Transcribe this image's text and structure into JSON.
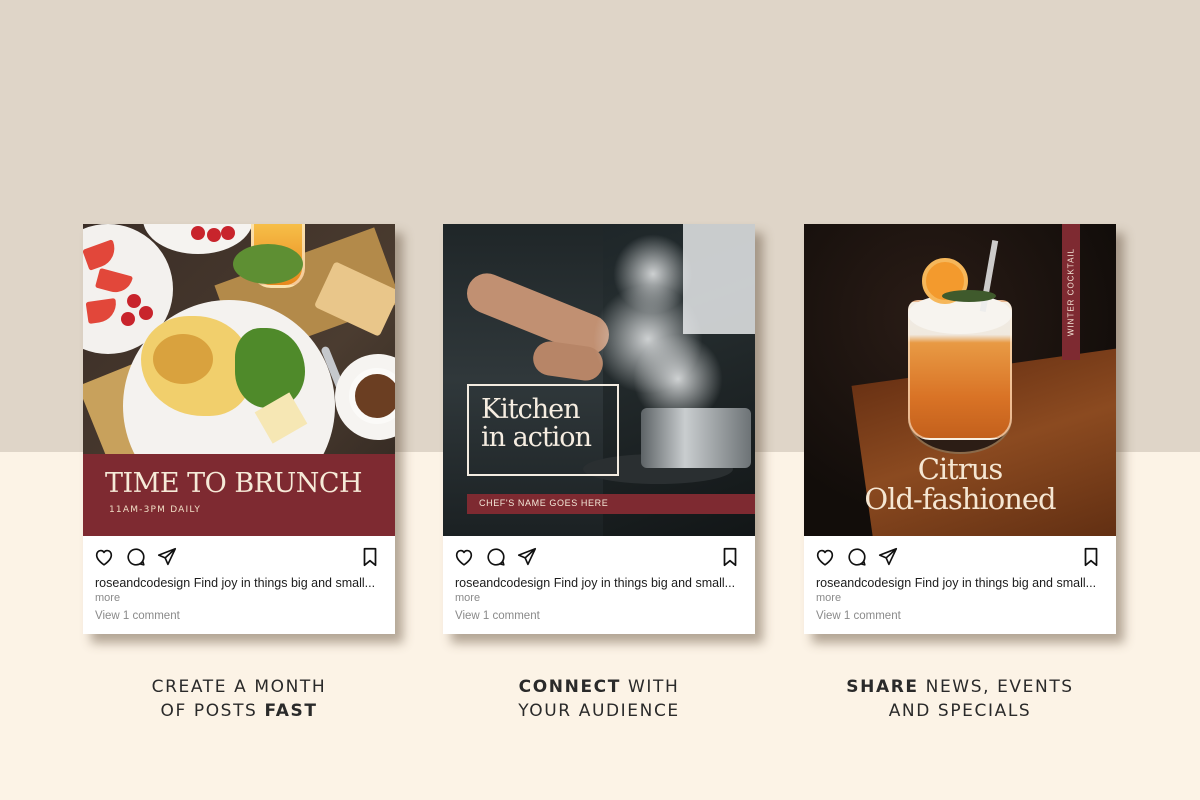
{
  "colors": {
    "top_background": "#dfd5c8",
    "bottom_background": "#fcf3e6",
    "accent_burgundy": "#7e2a31"
  },
  "posts": [
    {
      "overlay": {
        "title": "TIME TO BRUNCH",
        "subtitle": "11AM-3PM DAILY"
      },
      "username": "roseandcodesign",
      "caption": "Find joy in things big and small...",
      "more": "more",
      "comments": "View 1 comment",
      "icons": [
        "heart-icon",
        "comment-icon",
        "share-icon",
        "bookmark-icon"
      ]
    },
    {
      "overlay": {
        "title_line1": "Kitchen",
        "title_line2": "in action",
        "subtitle": "CHEF'S NAME GOES HERE"
      },
      "username": "roseandcodesign",
      "caption": "Find joy in things big and small...",
      "more": "more",
      "comments": "View 1 comment",
      "icons": [
        "heart-icon",
        "comment-icon",
        "share-icon",
        "bookmark-icon"
      ]
    },
    {
      "overlay": {
        "tag": "WINTER COCKTAIL",
        "title_line1": "Citrus",
        "title_line2": "Old-fashioned"
      },
      "username": "roseandcodesign",
      "caption": "Find joy in things big and small...",
      "more": "more",
      "comments": "View 1 comment",
      "icons": [
        "heart-icon",
        "comment-icon",
        "share-icon",
        "bookmark-icon"
      ]
    }
  ],
  "taglines": [
    {
      "line1": "CREATE A MONTH",
      "line2_pre": "OF POSTS ",
      "line2_bold": "FAST"
    },
    {
      "line1_bold": "CONNECT",
      "line1_post": " WITH",
      "line2": "YOUR AUDIENCE"
    },
    {
      "line1_bold": "SHARE",
      "line1_post": " NEWS, EVENTS",
      "line2": "AND SPECIALS"
    }
  ]
}
